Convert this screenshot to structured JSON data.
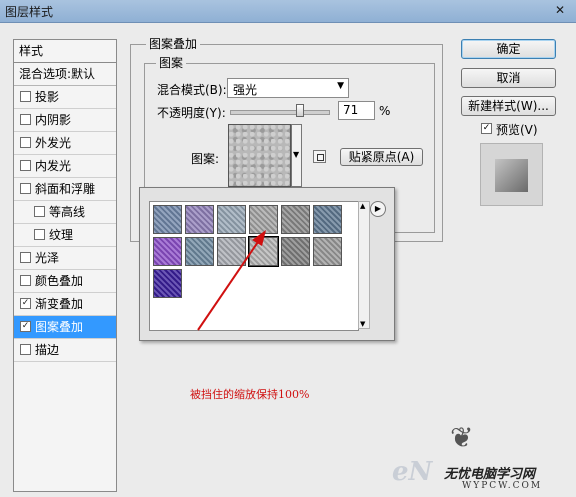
{
  "window": {
    "title": "图层样式",
    "close_glyph": "✕"
  },
  "styles_panel": {
    "header": "样式",
    "blend_options": "混合选项:默认",
    "items": [
      {
        "label": "投影",
        "checked": false,
        "indent": false,
        "selected": false
      },
      {
        "label": "内阴影",
        "checked": false,
        "indent": false,
        "selected": false
      },
      {
        "label": "外发光",
        "checked": false,
        "indent": false,
        "selected": false
      },
      {
        "label": "内发光",
        "checked": false,
        "indent": false,
        "selected": false
      },
      {
        "label": "斜面和浮雕",
        "checked": false,
        "indent": false,
        "selected": false
      },
      {
        "label": "等高线",
        "checked": false,
        "indent": true,
        "selected": false
      },
      {
        "label": "纹理",
        "checked": false,
        "indent": true,
        "selected": false
      },
      {
        "label": "光泽",
        "checked": false,
        "indent": false,
        "selected": false
      },
      {
        "label": "颜色叠加",
        "checked": false,
        "indent": false,
        "selected": false
      },
      {
        "label": "渐变叠加",
        "checked": true,
        "indent": false,
        "selected": false
      },
      {
        "label": "图案叠加",
        "checked": true,
        "indent": false,
        "selected": true
      },
      {
        "label": "描边",
        "checked": false,
        "indent": false,
        "selected": false
      }
    ]
  },
  "pattern_overlay": {
    "group_title": "图案叠加",
    "subgroup_title": "图案",
    "blend_mode_label": "混合模式(B):",
    "blend_mode_value": "强光",
    "opacity_label": "不透明度(Y):",
    "opacity_value": "71",
    "opacity_fraction": 0.71,
    "opacity_unit": "%",
    "pattern_label": "图案:",
    "snap_origin_button": "贴紧原点(A)"
  },
  "pattern_picker": {
    "swatch_colors": [
      "#6f86a8",
      "#8f7fb8",
      "#97a7b6",
      "#a3a3a3",
      "#8a8a8a",
      "#5f7892",
      "#8c4fc9",
      "#6e8aa0",
      "#a9acb3",
      "#b4b4b4",
      "#7e7e7e",
      "#9a9a9a",
      "#3a1f9c"
    ],
    "selected_index": 9,
    "menu_glyph": "▶"
  },
  "actions": {
    "ok": "确定",
    "cancel": "取消",
    "new_style": "新建样式(W)...",
    "preview_label": "预览(V)",
    "preview_checked": true
  },
  "annotation": {
    "text": "被挡住的缩放保持100%",
    "color": "#d01010"
  },
  "watermark": {
    "brand": "eN",
    "site_cn": "无忧电脑学习网",
    "site_url": "WYPCW.COM"
  }
}
